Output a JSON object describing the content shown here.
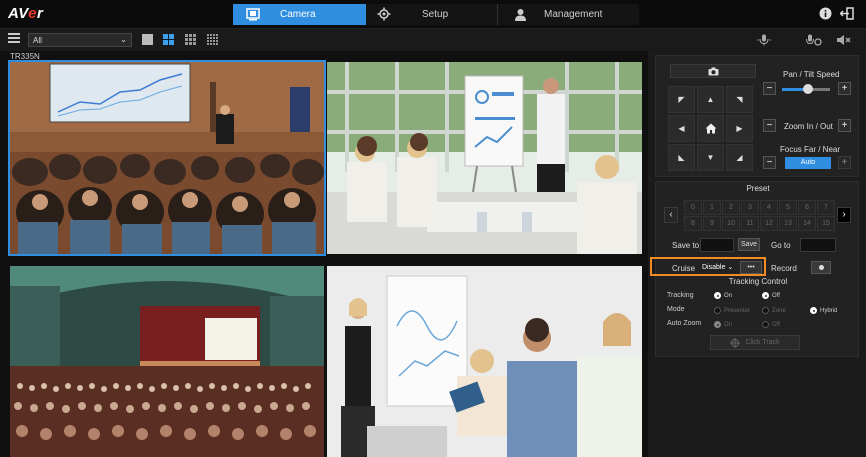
{
  "brand": {
    "logo_text": "AVer"
  },
  "main_tabs": [
    {
      "label": "Camera",
      "icon": "camera-icon",
      "active": true
    },
    {
      "label": "Setup",
      "icon": "gear-icon",
      "active": false
    },
    {
      "label": "Management",
      "icon": "user-icon",
      "active": false
    }
  ],
  "toolbar": {
    "group_select_value": "All",
    "layouts": [
      "single",
      "2x2",
      "3x3",
      "4x4"
    ],
    "active_layout": "2x2"
  },
  "video": {
    "camera_name": "TR335N",
    "tiles": [
      {
        "scene": "lecture-hall-speaker",
        "selected": true
      },
      {
        "scene": "meeting-presenter-whiteboard",
        "selected": false
      },
      {
        "scene": "auditorium-audience",
        "selected": false
      },
      {
        "scene": "classroom-presenter",
        "selected": false
      }
    ]
  },
  "panel": {
    "pan_tilt_speed_label": "Pan / Tilt Speed",
    "pan_tilt_speed_value": 0.55,
    "zoom_label": "Zoom In / Out",
    "focus_label": "Focus Far / Near",
    "focus_auto_label": "Auto",
    "preset": {
      "title": "Preset",
      "numbers": [
        "0",
        "1",
        "2",
        "3",
        "4",
        "5",
        "6",
        "7",
        "8",
        "9",
        "10",
        "11",
        "12",
        "13",
        "14",
        "15"
      ],
      "save_to_label": "Save to",
      "save_button": "Save",
      "go_to_label": "Go to"
    },
    "cruise": {
      "label": "Cruise",
      "value": "Disable",
      "more_button": "•••"
    },
    "record_label": "Record",
    "tracking": {
      "title": "Tracking Control",
      "tracking_label": "Tracking",
      "tracking_on": "On",
      "tracking_off": "Off",
      "mode_label": "Mode",
      "mode_presenter": "Presenter",
      "mode_zone": "Zone",
      "mode_hybrid": "Hybrid",
      "auto_zoom_label": "Auto Zoom",
      "auto_zoom_on": "On",
      "auto_zoom_off": "Off",
      "click_track_button": "Click Track"
    }
  },
  "colors": {
    "accent": "#2f8ee0",
    "highlight": "#f08c22",
    "background": "#1b1b1b"
  }
}
